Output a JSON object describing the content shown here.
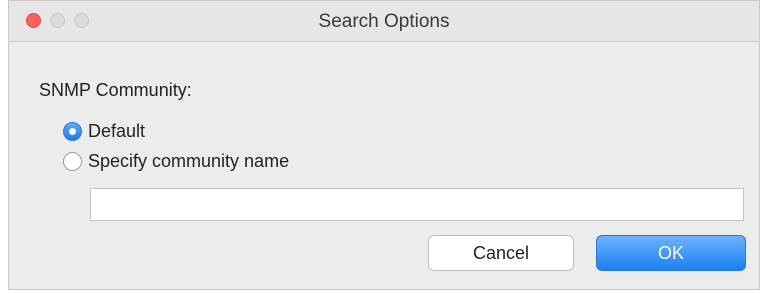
{
  "window": {
    "title": "Search Options"
  },
  "snmp": {
    "section_label": "SNMP Community:",
    "options": [
      {
        "label": "Default",
        "selected": true
      },
      {
        "label": "Specify community name",
        "selected": false
      }
    ],
    "community_name_value": ""
  },
  "buttons": {
    "cancel_label": "Cancel",
    "ok_label": "OK"
  },
  "colors": {
    "accent": "#1c7ef2",
    "close": "#fc605b",
    "window_bg": "#ececec"
  }
}
